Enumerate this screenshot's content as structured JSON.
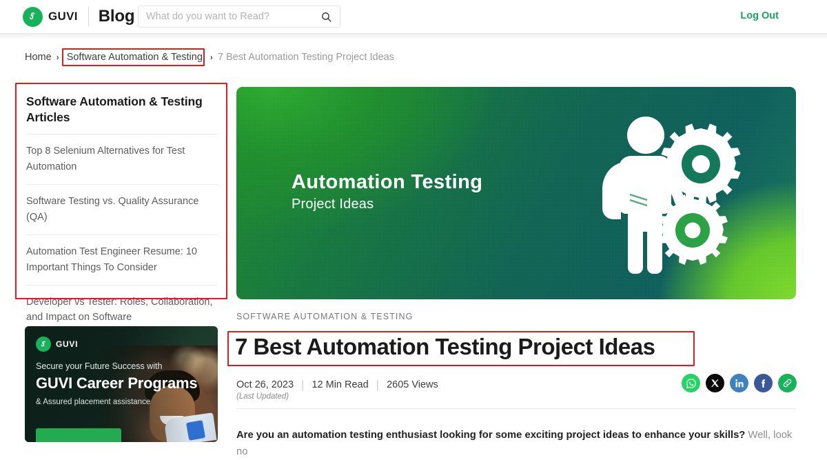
{
  "header": {
    "logo_icon": "guvi-logo-icon",
    "brand_name": "GUVI",
    "section_name": "Blog",
    "search": {
      "placeholder": "What do you want to Read?",
      "value": "",
      "icon": "search-icon"
    },
    "logout_label": "Log Out",
    "brand_green": "#18b25b",
    "accent_green": "#1aa75a"
  },
  "breadcrumb": {
    "home": "Home",
    "separator": "›",
    "category": "Software Automation & Testing",
    "current": "7 Best Automation Testing Project Ideas"
  },
  "sidebar": {
    "title": "Software Automation & Testing Articles",
    "items": [
      {
        "label": "Top 8 Selenium Alternatives for Test Automation"
      },
      {
        "label": "Software Testing vs. Quality Assurance (QA)"
      },
      {
        "label": "Automation Test Engineer Resume: 10 Important Things To Consider"
      },
      {
        "label": "Developer vs Tester: Roles, Collaboration, and Impact on Software"
      }
    ]
  },
  "promo": {
    "logo_icon": "guvi-logo-icon",
    "brand_name": "GUVI",
    "kicker": "Secure your Future Success with",
    "title": "GUVI Career Programs",
    "subtitle": "& Assured placement assistance",
    "button_color": "#24ab4f"
  },
  "hero": {
    "title": "Automation Testing",
    "subtitle": "Project Ideas",
    "art_icon": "student-with-gears-icon",
    "gradient_from": "#1e8c2d",
    "gradient_to": "#0d5f5c",
    "glow_color": "#7fdc2b"
  },
  "article": {
    "category": "SOFTWARE AUTOMATION & TESTING",
    "title": "7 Best Automation Testing Project Ideas",
    "date": "Oct 26, 2023",
    "read_time": "12 Min Read",
    "views": "2605 Views",
    "last_updated": "(Last Updated)",
    "intro_bold": "Are you an automation testing enthusiast looking for some exciting project ideas to enhance your skills?",
    "intro_rest": " Well, look no"
  },
  "social": [
    {
      "name": "whatsapp-share-button",
      "label": "WhatsApp",
      "color": "#25d366"
    },
    {
      "name": "x-share-button",
      "label": "X",
      "color": "#0a0a0a"
    },
    {
      "name": "linkedin-share-button",
      "label": "LinkedIn",
      "color": "#3d82bf"
    },
    {
      "name": "facebook-share-button",
      "label": "Facebook",
      "color": "#3b5998"
    },
    {
      "name": "copy-link-button",
      "label": "Copy Link",
      "color": "#18b25b"
    }
  ],
  "annotations": {
    "highlight_color": "#e01b24",
    "boxes": [
      {
        "name": "breadcrumb-category-highlight"
      },
      {
        "name": "sidebar-articles-highlight"
      },
      {
        "name": "article-title-highlight"
      }
    ]
  }
}
